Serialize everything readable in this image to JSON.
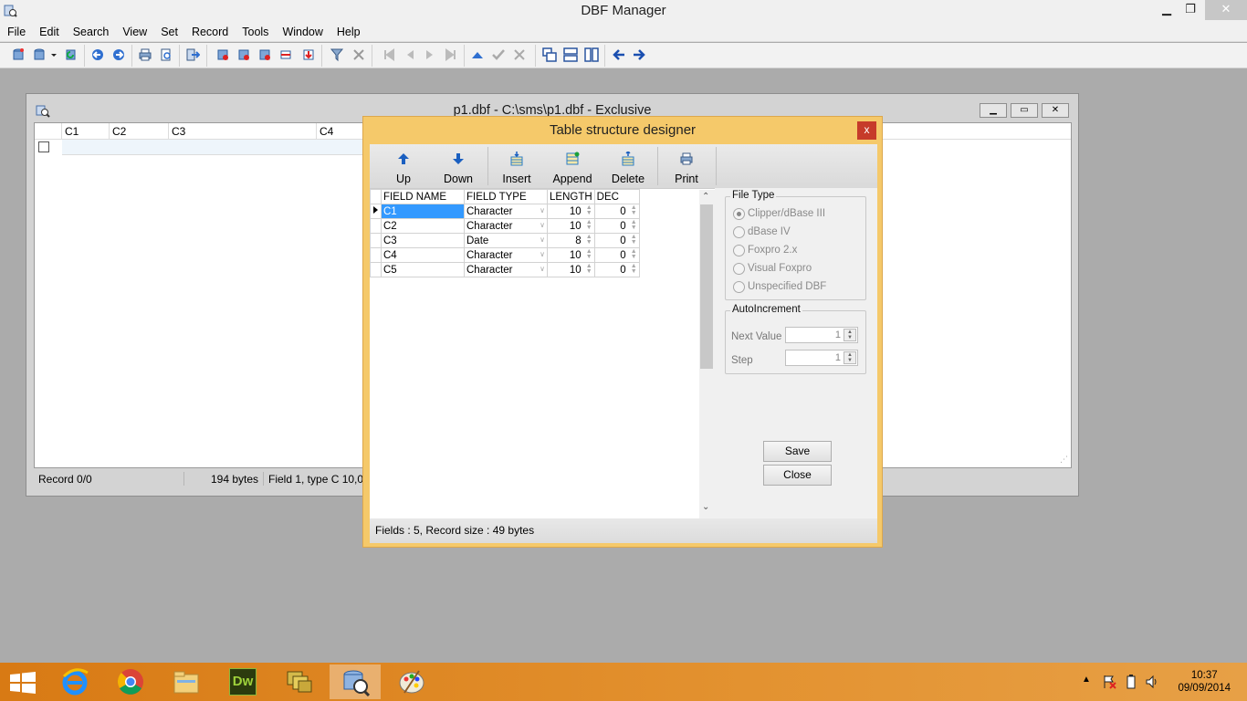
{
  "app": {
    "title": "DBF Manager",
    "window_buttons": {
      "minimize": "▁",
      "restore": "❐",
      "close": "✕"
    }
  },
  "menu": {
    "items": [
      "File",
      "Edit",
      "Search",
      "View",
      "Set",
      "Record",
      "Tools",
      "Window",
      "Help"
    ]
  },
  "child_window": {
    "title": "p1.dbf - C:\\sms\\p1.dbf - Exclusive",
    "columns": [
      "C1",
      "C2",
      "C3",
      "C4"
    ],
    "status": {
      "record": "Record 0/0",
      "bytes": "194 bytes",
      "field": "Field 1, type C 10,0"
    }
  },
  "dialog": {
    "title": "Table structure designer",
    "close_label": "x",
    "toolbar": {
      "up": "Up",
      "down": "Down",
      "insert": "Insert",
      "append": "Append",
      "delete": "Delete",
      "print": "Print"
    },
    "grid": {
      "headers": [
        "FIELD NAME",
        "FIELD TYPE",
        "LENGTH",
        "DEC"
      ],
      "rows": [
        {
          "name": "C1",
          "type": "Character",
          "length": "10",
          "dec": "0"
        },
        {
          "name": "C2",
          "type": "Character",
          "length": "10",
          "dec": "0"
        },
        {
          "name": "C3",
          "type": "Date",
          "length": "8",
          "dec": "0"
        },
        {
          "name": "C4",
          "type": "Character",
          "length": "10",
          "dec": "0"
        },
        {
          "name": "C5",
          "type": "Character",
          "length": "10",
          "dec": "0"
        }
      ]
    },
    "file_type": {
      "legend": "File Type",
      "options": [
        "Clipper/dBase III",
        "dBase IV",
        "Foxpro 2.x",
        "Visual Foxpro",
        "Unspecified DBF"
      ],
      "selected": "Clipper/dBase III"
    },
    "auto_increment": {
      "legend": "AutoIncrement",
      "next_value_label": "Next Value",
      "next_value": "1",
      "step_label": "Step",
      "step": "1"
    },
    "buttons": {
      "save": "Save",
      "close": "Close"
    },
    "status": "Fields : 5, Record size : 49 bytes"
  },
  "taskbar": {
    "apps": [
      "start",
      "internet-explorer",
      "chrome",
      "file-explorer",
      "dreamweaver",
      "stacked-app",
      "dbf-manager",
      "paint"
    ],
    "dreamweaver_label": "Dw",
    "clock_time": "10:37",
    "clock_date": "09/09/2014"
  }
}
